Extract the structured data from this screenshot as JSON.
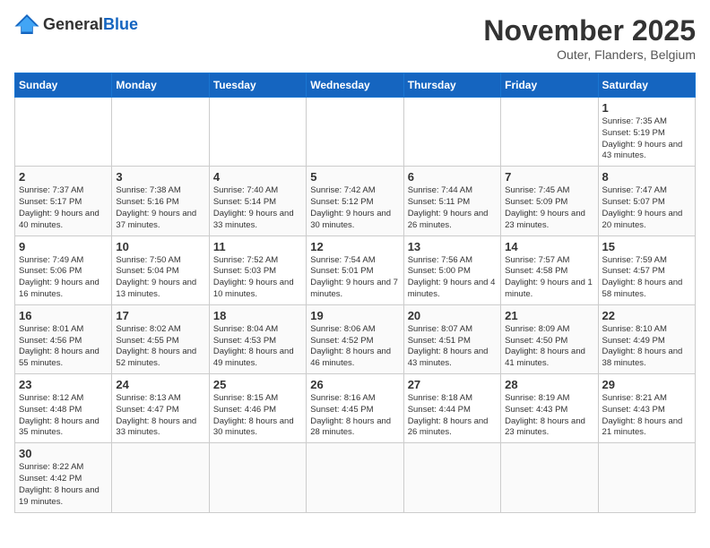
{
  "header": {
    "logo_general": "General",
    "logo_blue": "Blue",
    "month": "November 2025",
    "location": "Outer, Flanders, Belgium"
  },
  "weekdays": [
    "Sunday",
    "Monday",
    "Tuesday",
    "Wednesday",
    "Thursday",
    "Friday",
    "Saturday"
  ],
  "weeks": [
    [
      {
        "day": "",
        "info": ""
      },
      {
        "day": "",
        "info": ""
      },
      {
        "day": "",
        "info": ""
      },
      {
        "day": "",
        "info": ""
      },
      {
        "day": "",
        "info": ""
      },
      {
        "day": "",
        "info": ""
      },
      {
        "day": "1",
        "info": "Sunrise: 7:35 AM\nSunset: 5:19 PM\nDaylight: 9 hours\nand 43 minutes."
      }
    ],
    [
      {
        "day": "2",
        "info": "Sunrise: 7:37 AM\nSunset: 5:17 PM\nDaylight: 9 hours\nand 40 minutes."
      },
      {
        "day": "3",
        "info": "Sunrise: 7:38 AM\nSunset: 5:16 PM\nDaylight: 9 hours\nand 37 minutes."
      },
      {
        "day": "4",
        "info": "Sunrise: 7:40 AM\nSunset: 5:14 PM\nDaylight: 9 hours\nand 33 minutes."
      },
      {
        "day": "5",
        "info": "Sunrise: 7:42 AM\nSunset: 5:12 PM\nDaylight: 9 hours\nand 30 minutes."
      },
      {
        "day": "6",
        "info": "Sunrise: 7:44 AM\nSunset: 5:11 PM\nDaylight: 9 hours\nand 26 minutes."
      },
      {
        "day": "7",
        "info": "Sunrise: 7:45 AM\nSunset: 5:09 PM\nDaylight: 9 hours\nand 23 minutes."
      },
      {
        "day": "8",
        "info": "Sunrise: 7:47 AM\nSunset: 5:07 PM\nDaylight: 9 hours\nand 20 minutes."
      }
    ],
    [
      {
        "day": "9",
        "info": "Sunrise: 7:49 AM\nSunset: 5:06 PM\nDaylight: 9 hours\nand 16 minutes."
      },
      {
        "day": "10",
        "info": "Sunrise: 7:50 AM\nSunset: 5:04 PM\nDaylight: 9 hours\nand 13 minutes."
      },
      {
        "day": "11",
        "info": "Sunrise: 7:52 AM\nSunset: 5:03 PM\nDaylight: 9 hours\nand 10 minutes."
      },
      {
        "day": "12",
        "info": "Sunrise: 7:54 AM\nSunset: 5:01 PM\nDaylight: 9 hours\nand 7 minutes."
      },
      {
        "day": "13",
        "info": "Sunrise: 7:56 AM\nSunset: 5:00 PM\nDaylight: 9 hours\nand 4 minutes."
      },
      {
        "day": "14",
        "info": "Sunrise: 7:57 AM\nSunset: 4:58 PM\nDaylight: 9 hours\nand 1 minute."
      },
      {
        "day": "15",
        "info": "Sunrise: 7:59 AM\nSunset: 4:57 PM\nDaylight: 8 hours\nand 58 minutes."
      }
    ],
    [
      {
        "day": "16",
        "info": "Sunrise: 8:01 AM\nSunset: 4:56 PM\nDaylight: 8 hours\nand 55 minutes."
      },
      {
        "day": "17",
        "info": "Sunrise: 8:02 AM\nSunset: 4:55 PM\nDaylight: 8 hours\nand 52 minutes."
      },
      {
        "day": "18",
        "info": "Sunrise: 8:04 AM\nSunset: 4:53 PM\nDaylight: 8 hours\nand 49 minutes."
      },
      {
        "day": "19",
        "info": "Sunrise: 8:06 AM\nSunset: 4:52 PM\nDaylight: 8 hours\nand 46 minutes."
      },
      {
        "day": "20",
        "info": "Sunrise: 8:07 AM\nSunset: 4:51 PM\nDaylight: 8 hours\nand 43 minutes."
      },
      {
        "day": "21",
        "info": "Sunrise: 8:09 AM\nSunset: 4:50 PM\nDaylight: 8 hours\nand 41 minutes."
      },
      {
        "day": "22",
        "info": "Sunrise: 8:10 AM\nSunset: 4:49 PM\nDaylight: 8 hours\nand 38 minutes."
      }
    ],
    [
      {
        "day": "23",
        "info": "Sunrise: 8:12 AM\nSunset: 4:48 PM\nDaylight: 8 hours\nand 35 minutes."
      },
      {
        "day": "24",
        "info": "Sunrise: 8:13 AM\nSunset: 4:47 PM\nDaylight: 8 hours\nand 33 minutes."
      },
      {
        "day": "25",
        "info": "Sunrise: 8:15 AM\nSunset: 4:46 PM\nDaylight: 8 hours\nand 30 minutes."
      },
      {
        "day": "26",
        "info": "Sunrise: 8:16 AM\nSunset: 4:45 PM\nDaylight: 8 hours\nand 28 minutes."
      },
      {
        "day": "27",
        "info": "Sunrise: 8:18 AM\nSunset: 4:44 PM\nDaylight: 8 hours\nand 26 minutes."
      },
      {
        "day": "28",
        "info": "Sunrise: 8:19 AM\nSunset: 4:43 PM\nDaylight: 8 hours\nand 23 minutes."
      },
      {
        "day": "29",
        "info": "Sunrise: 8:21 AM\nSunset: 4:43 PM\nDaylight: 8 hours\nand 21 minutes."
      }
    ],
    [
      {
        "day": "30",
        "info": "Sunrise: 8:22 AM\nSunset: 4:42 PM\nDaylight: 8 hours\nand 19 minutes."
      },
      {
        "day": "",
        "info": ""
      },
      {
        "day": "",
        "info": ""
      },
      {
        "day": "",
        "info": ""
      },
      {
        "day": "",
        "info": ""
      },
      {
        "day": "",
        "info": ""
      },
      {
        "day": "",
        "info": ""
      }
    ]
  ]
}
